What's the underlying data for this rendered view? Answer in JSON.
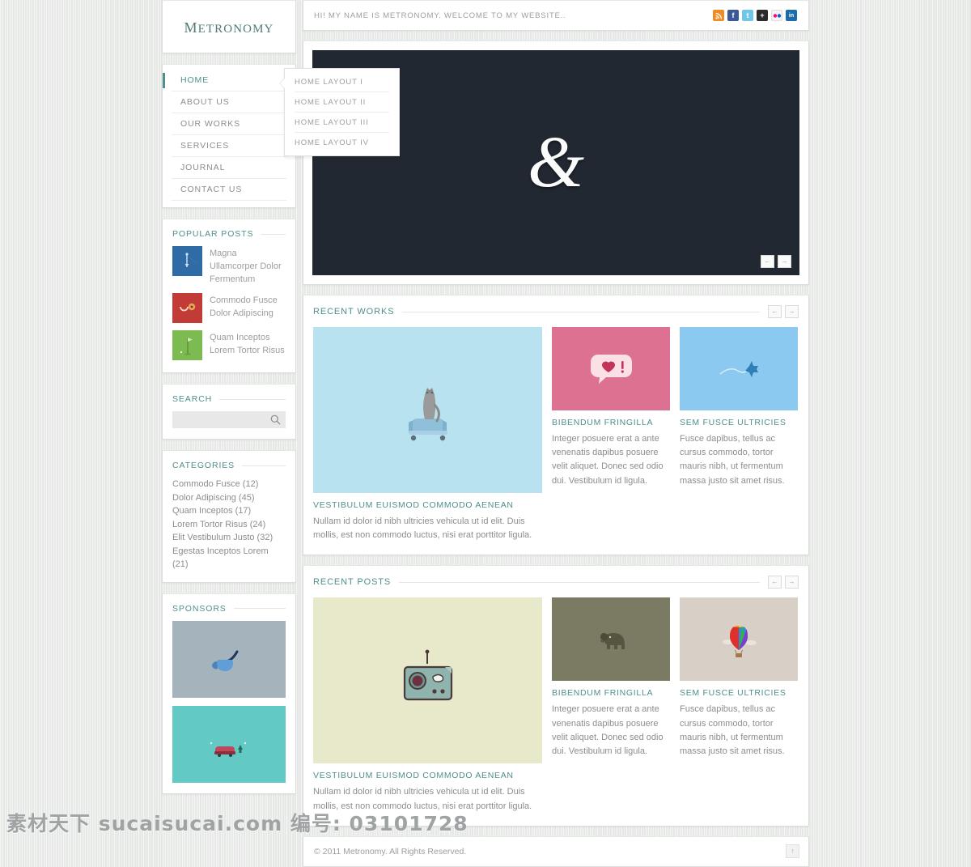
{
  "site": {
    "logo": "Metronomy",
    "topbar_message": "HI! MY NAME IS METRONOMY. WELCOME TO MY WEBSITE..",
    "footer_text": "© 2011 Metronomy. All Rights Reserved.",
    "watermark": "素材天下 sucaisucai.com 编号: 03101728",
    "accent_color": "#4f8f8c",
    "logo_color": "#4f7b76",
    "body_text_color": "#8a8e8f",
    "page_bg": "#e9ebe9"
  },
  "social": [
    {
      "name": "rss-icon",
      "label": "RSS",
      "glyph": "≈",
      "bg": "#f08a23"
    },
    {
      "name": "facebook-icon",
      "label": "Facebook",
      "glyph": "f",
      "bg": "#3b5998"
    },
    {
      "name": "twitter-icon",
      "label": "Twitter",
      "glyph": "t",
      "bg": "#6fc7e8"
    },
    {
      "name": "addthis-icon",
      "label": "Add This",
      "glyph": "+",
      "bg": "#2b2b2b"
    },
    {
      "name": "flickr-icon",
      "label": "Flickr",
      "glyph": "••",
      "bg": "#f4f4f4"
    },
    {
      "name": "linkedin-icon",
      "label": "LinkedIn",
      "glyph": "in",
      "bg": "#1b6ca8"
    }
  ],
  "nav": {
    "items": [
      {
        "label": "Home",
        "active": true
      },
      {
        "label": "About Us",
        "active": false
      },
      {
        "label": "Our Works",
        "active": false
      },
      {
        "label": "Services",
        "active": false
      },
      {
        "label": "Journal",
        "active": false
      },
      {
        "label": "Contact Us",
        "active": false
      }
    ],
    "submenu": {
      "items": [
        {
          "label": "Home Layout I"
        },
        {
          "label": "Home Layout II"
        },
        {
          "label": "Home Layout III"
        },
        {
          "label": "Home Layout IV"
        }
      ]
    }
  },
  "popular_posts": {
    "title": "Popular Posts",
    "items": [
      {
        "title": "Magna Ullamcorper Dolor Fermentum",
        "thumb": "needle",
        "bg": "#2f6ca5"
      },
      {
        "title": "Commodo Fusce Dolor Adipiscing",
        "thumb": "smiley",
        "bg": "#c23b36"
      },
      {
        "title": "Quam Inceptos Lorem Tortor Risus",
        "thumb": "golf-flag",
        "bg": "#7cba52"
      }
    ]
  },
  "search": {
    "title": "Search",
    "value": "",
    "placeholder": ""
  },
  "categories": {
    "title": "Categories",
    "items": [
      "Commodo Fusce (12)",
      "Dolor Adipiscing (45)",
      "Quam Inceptos (17)",
      "Lorem Tortor Risus (24)",
      "Elit Vestibulum Justo (32)",
      "Egestas Inceptos Lorem (21)"
    ]
  },
  "sponsors": {
    "title": "Sponsors",
    "items": [
      {
        "name": "pipe-banner",
        "bg": "#a5b4bc",
        "art": "pipe"
      },
      {
        "name": "car-banner",
        "bg": "#63c9c4",
        "art": "car"
      }
    ]
  },
  "slider": {
    "glyph": "&",
    "bg": "#222832",
    "prev_label": "←",
    "next_label": "→"
  },
  "recent_works": {
    "title": "Recent Works",
    "prev_label": "←",
    "next_label": "→",
    "cards": [
      {
        "title": "Vestibulum Euismod Commodo Aenean",
        "text": "Nullam id dolor id nibh ultricies vehicula ut id elit. Duis mollis, est non commodo luctus, nisi erat porttitor ligula.",
        "bg": "#b9e2f0",
        "art": "cat-chair",
        "size": "big"
      },
      {
        "title": "Bibendum Fringilla",
        "text": "Integer posuere erat a ante venenatis dapibus posuere velit aliquet. Donec sed odio dui. Vestibulum id ligula.",
        "bg": "#dd7192",
        "art": "heart-bubble",
        "size": "small"
      },
      {
        "title": "Sem Fusce Ultricies",
        "text": "Fusce dapibus, tellus ac cursus commodo, tortor mauris nibh, ut fermentum massa justo sit amet risus.",
        "bg": "#8cc9f0",
        "art": "airplane",
        "size": "small"
      }
    ]
  },
  "recent_posts": {
    "title": "Recent Posts",
    "prev_label": "←",
    "next_label": "→",
    "cards": [
      {
        "title": "Vestibulum Euismod Commodo Aenean",
        "text": "Nullam id dolor id nibh ultricies vehicula ut id elit. Duis mollis, est non commodo luctus, nisi erat porttitor ligula.",
        "bg": "#e8e8cb",
        "art": "radio",
        "size": "big"
      },
      {
        "title": "Bibendum Fringilla",
        "text": "Integer posuere erat a ante venenatis dapibus posuere velit aliquet. Donec sed odio dui. Vestibulum id ligula.",
        "bg": "#7b7a63",
        "art": "elephant",
        "size": "small"
      },
      {
        "title": "Sem Fusce Ultricies",
        "text": "Fusce dapibus, tellus ac cursus commodo, tortor mauris nibh, ut fermentum massa justo sit amet risus.",
        "bg": "#d8d0c6",
        "art": "balloon",
        "size": "small"
      }
    ]
  },
  "footer": {
    "back_to_top_label": "↑"
  }
}
